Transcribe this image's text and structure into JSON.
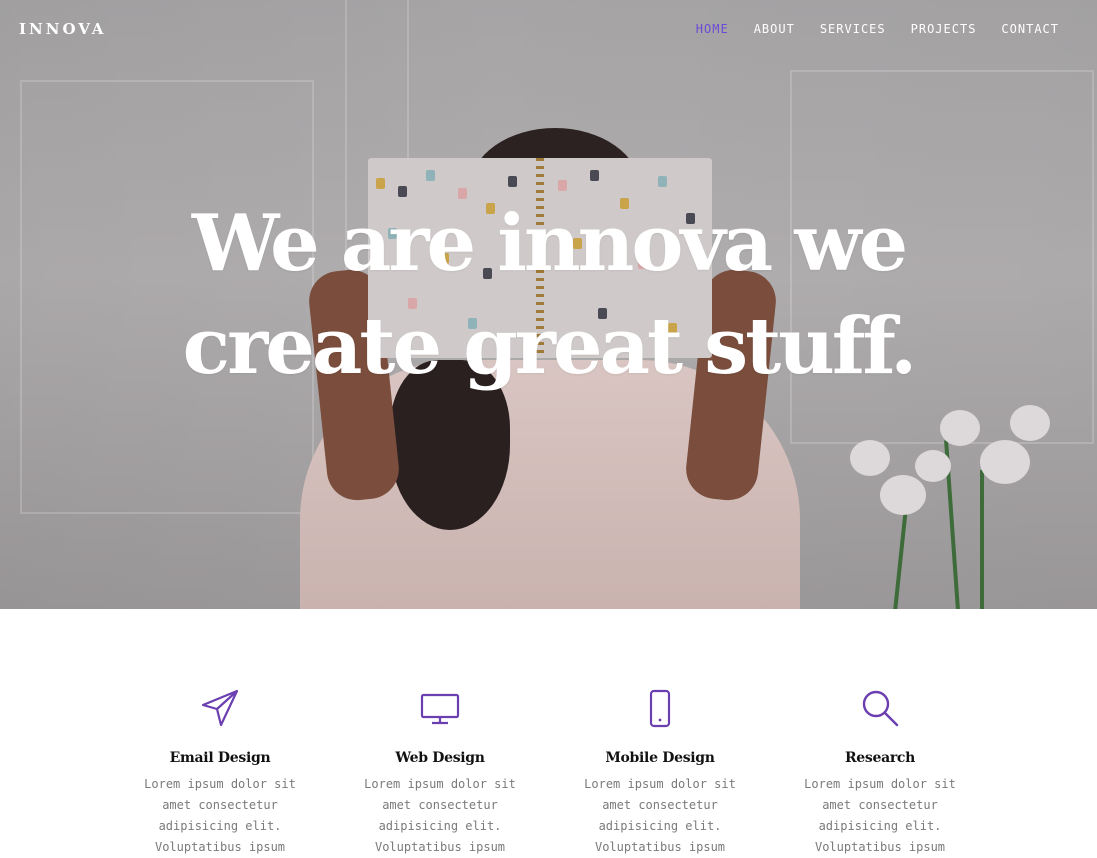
{
  "brand": {
    "name": "INNOVA",
    "accent": "#6b4bd6"
  },
  "nav": {
    "items": [
      {
        "label": "HOME",
        "active": true
      },
      {
        "label": "ABOUT",
        "active": false
      },
      {
        "label": "SERVICES",
        "active": false
      },
      {
        "label": "PROJECTS",
        "active": false
      },
      {
        "label": "CONTACT",
        "active": false
      }
    ]
  },
  "hero": {
    "line1": "We are innova we",
    "line2": "create great stuff."
  },
  "services": [
    {
      "title": "Email Design",
      "icon": "paper-plane-icon",
      "text": "Lorem ipsum dolor sit amet consectetur adipisicing elit. Voluptatibus ipsum"
    },
    {
      "title": "Web Design",
      "icon": "monitor-icon",
      "text": "Lorem ipsum dolor sit amet consectetur adipisicing elit. Voluptatibus ipsum"
    },
    {
      "title": "Mobile Design",
      "icon": "smartphone-icon",
      "text": "Lorem ipsum dolor sit amet consectetur adipisicing elit. Voluptatibus ipsum"
    },
    {
      "title": "Research",
      "icon": "search-icon",
      "text": "Lorem ipsum dolor sit amet consectetur adipisicing elit. Voluptatibus ipsum"
    }
  ]
}
